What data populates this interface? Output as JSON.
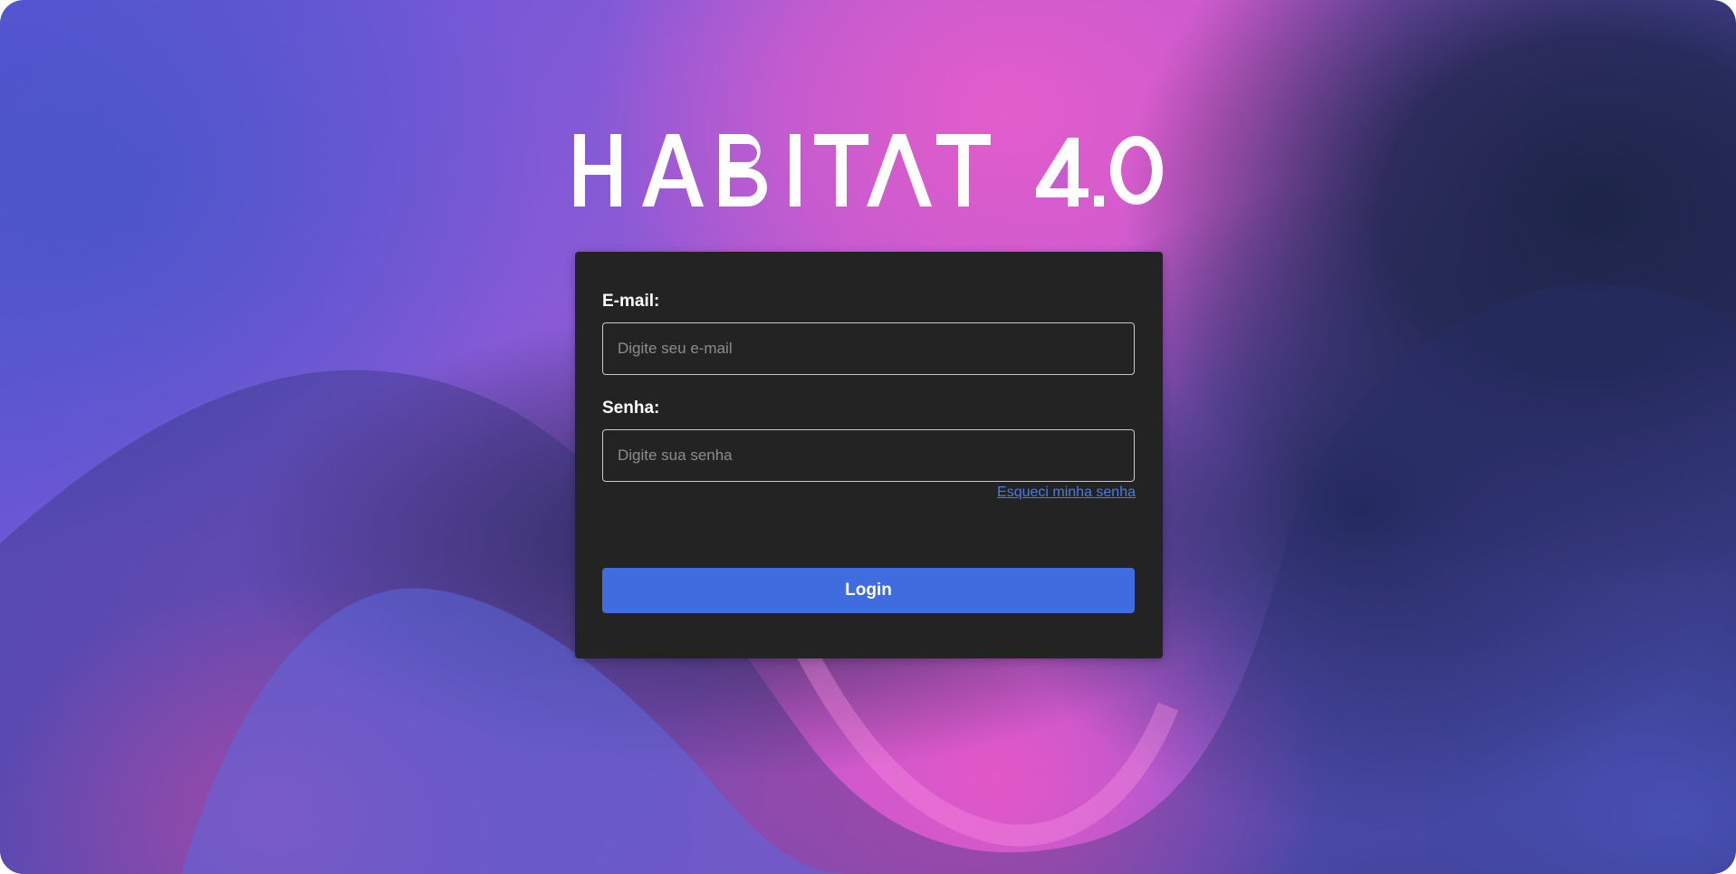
{
  "brand": {
    "logo_text": "HABITAT 4.0"
  },
  "login_form": {
    "email_label": "E-mail:",
    "email_placeholder": "Digite seu e-mail",
    "email_value": "",
    "password_label": "Senha:",
    "password_placeholder": "Digite sua senha",
    "password_value": "",
    "forgot_password_link": "Esqueci minha senha",
    "login_button": "Login"
  },
  "colors": {
    "card_background": "#232323",
    "button_accent": "#3f6de0",
    "link": "#4a7ae6",
    "background_pink": "#e35ccb",
    "background_blue": "#5a56d6",
    "background_navy": "#1d2448"
  }
}
